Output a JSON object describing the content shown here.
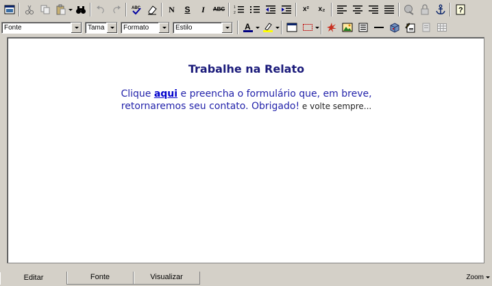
{
  "toolbar": {
    "selects": {
      "fonte": "Fonte",
      "tamanho": "Tama",
      "formato": "Formato",
      "estilo": "Estilo"
    },
    "bold_label": "N",
    "underline_label": "S",
    "italic_label": "I",
    "strike_label": "ABC",
    "spell_label": "ABC",
    "super_label": "x²",
    "sub_label": "x₂"
  },
  "colors": {
    "text_color": "#000080",
    "highlight_color": "#ffff00",
    "title_color": "#1a1a7a",
    "body_color": "#2222aa"
  },
  "document": {
    "title": "Trabalhe na Relato",
    "line1_before": "Clique ",
    "link_text": "aqui",
    "line1_after": " e preencha o formulário que, em breve,",
    "line2": "retornaremos seu contato. Obrigado!",
    "line2_tail": " e volte sempre..."
  },
  "tabs": [
    "Editar",
    "Fonte",
    "Visualizar"
  ],
  "zoom_label": "Zoom"
}
